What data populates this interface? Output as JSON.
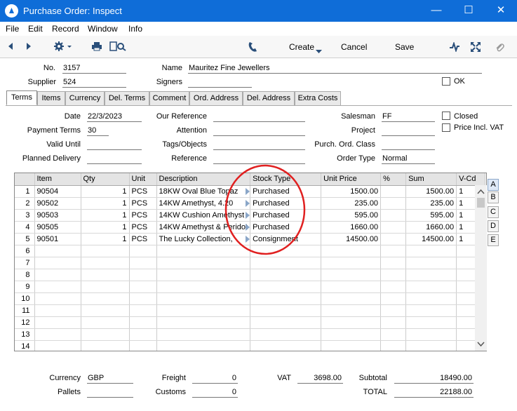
{
  "window": {
    "title": "Purchase Order: Inspect",
    "minimize_glyph": "—",
    "maximize_glyph": "☐",
    "close_glyph": "✕"
  },
  "menu": [
    "File",
    "Edit",
    "Record",
    "Window",
    "Info"
  ],
  "toolbar": {
    "create": "Create",
    "cancel": "Cancel",
    "save": "Save"
  },
  "header": {
    "no_label": "No.",
    "no": "3157",
    "name_label": "Name",
    "name": "Mauritez Fine Jewellers",
    "supplier_label": "Supplier",
    "supplier": "524",
    "signers_label": "Signers",
    "signers": "",
    "ok_label": "OK"
  },
  "tabs": [
    "Terms",
    "Items",
    "Currency",
    "Del. Terms",
    "Comment",
    "Ord. Address",
    "Del. Address",
    "Extra Costs"
  ],
  "terms": {
    "date_label": "Date",
    "date": "22/3/2023",
    "payment_terms_label": "Payment Terms",
    "payment_terms": "30",
    "valid_until_label": "Valid Until",
    "valid_until": "",
    "planned_delivery_label": "Planned Delivery",
    "planned_delivery": "",
    "our_reference_label": "Our Reference",
    "our_reference": "",
    "attention_label": "Attention",
    "attention": "",
    "tags_label": "Tags/Objects",
    "tags": "",
    "reference_label": "Reference",
    "reference": "",
    "salesman_label": "Salesman",
    "salesman": "FF",
    "project_label": "Project",
    "project": "",
    "purch_ord_class_label": "Purch. Ord. Class",
    "purch_ord_class": "",
    "order_type_label": "Order Type",
    "order_type": "Normal",
    "closed_label": "Closed",
    "price_incl_vat_label": "Price Incl. VAT"
  },
  "grid": {
    "columns": [
      "",
      "Item",
      "Qty",
      "Unit",
      "Description",
      "Stock Type",
      "Unit Price",
      "%",
      "Sum",
      "V-Cd"
    ],
    "rows": [
      [
        "1",
        "90504",
        "1",
        "PCS",
        "18KW Oval Blue Topaz",
        "Purchased",
        "1500.00",
        "",
        "1500.00",
        "1"
      ],
      [
        "2",
        "90502",
        "1",
        "PCS",
        "14KW Amethyst, 4.20",
        "Purchased",
        "235.00",
        "",
        "235.00",
        "1"
      ],
      [
        "3",
        "90503",
        "1",
        "PCS",
        "14KW Cushion Amethyst",
        "Purchased",
        "595.00",
        "",
        "595.00",
        "1"
      ],
      [
        "4",
        "90505",
        "1",
        "PCS",
        "14KW Amethyst & Peridot",
        "Purchased",
        "1660.00",
        "",
        "1660.00",
        "1"
      ],
      [
        "5",
        "90501",
        "1",
        "PCS",
        "The Lucky Collection,",
        "Consignment",
        "14500.00",
        "",
        "14500.00",
        "1"
      ],
      [
        "6",
        "",
        "",
        "",
        "",
        "",
        "",
        "",
        "",
        ""
      ],
      [
        "7",
        "",
        "",
        "",
        "",
        "",
        "",
        "",
        "",
        ""
      ],
      [
        "8",
        "",
        "",
        "",
        "",
        "",
        "",
        "",
        "",
        ""
      ],
      [
        "9",
        "",
        "",
        "",
        "",
        "",
        "",
        "",
        "",
        ""
      ],
      [
        "10",
        "",
        "",
        "",
        "",
        "",
        "",
        "",
        "",
        ""
      ],
      [
        "11",
        "",
        "",
        "",
        "",
        "",
        "",
        "",
        "",
        ""
      ],
      [
        "12",
        "",
        "",
        "",
        "",
        "",
        "",
        "",
        "",
        ""
      ],
      [
        "13",
        "",
        "",
        "",
        "",
        "",
        "",
        "",
        "",
        ""
      ],
      [
        "14",
        "",
        "",
        "",
        "",
        "",
        "",
        "",
        "",
        ""
      ]
    ],
    "flip_tabs": [
      "A",
      "B",
      "C",
      "D",
      "E"
    ]
  },
  "footer": {
    "currency_label": "Currency",
    "currency": "GBP",
    "pallets_label": "Pallets",
    "pallets": "",
    "freight_label": "Freight",
    "freight": "0",
    "customs_label": "Customs",
    "customs": "0",
    "vat_label": "VAT",
    "vat": "3698.00",
    "subtotal_label": "Subtotal",
    "subtotal": "18490.00",
    "total_label": "TOTAL",
    "total": "22188.00"
  },
  "colors": {
    "titlebar": "#0f6dd8",
    "annotation": "#e02020"
  }
}
